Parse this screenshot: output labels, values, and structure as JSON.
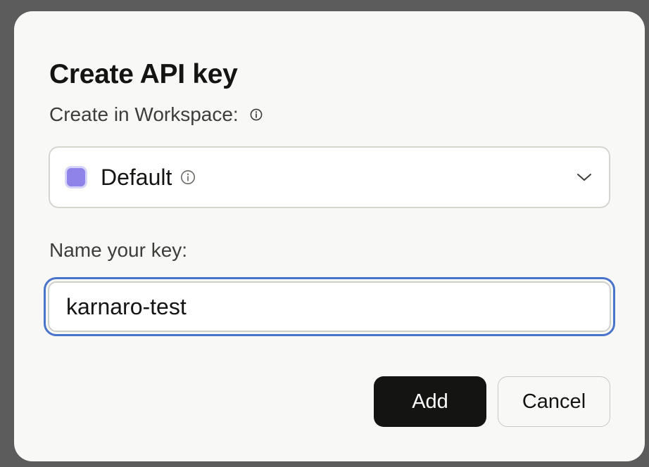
{
  "dialog": {
    "title": "Create API key",
    "workspace_label": "Create in Workspace:",
    "workspace_select": {
      "value": "Default",
      "swatch_color": "#8f83ea"
    },
    "name_label": "Name your key:",
    "name_input": {
      "value": "karnaro-test"
    },
    "buttons": {
      "add_label": "Add",
      "cancel_label": "Cancel"
    }
  },
  "colors": {
    "focus_ring": "#4a74c9",
    "primary_button": "#141413",
    "dialog_background": "#f8f8f6",
    "backdrop": "#5c5c5c"
  },
  "icons": {
    "workspace_info": "info-icon",
    "default_info": "info-icon",
    "dropdown": "chevron-down-icon"
  }
}
